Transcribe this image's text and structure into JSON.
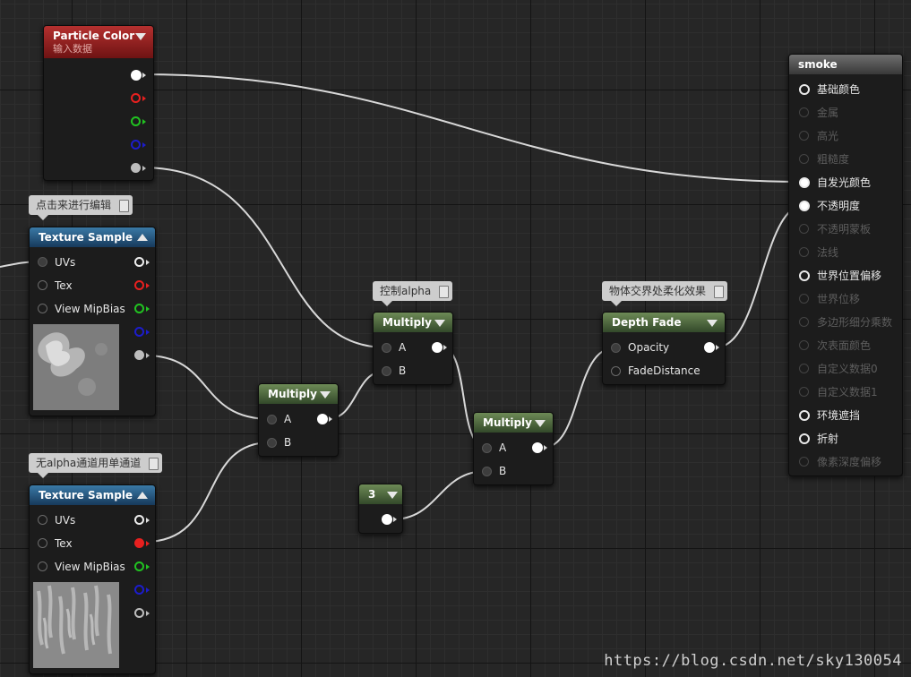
{
  "particle_color": {
    "title": "Particle Color",
    "subtitle": "输入数据"
  },
  "texture_sample_1": {
    "comment": "点击来进行编辑",
    "title": "Texture Sample",
    "inputs": [
      "UVs",
      "Tex",
      "View MipBias"
    ]
  },
  "texture_sample_2": {
    "comment": "无alpha通道用单通道",
    "title": "Texture Sample",
    "inputs": [
      "UVs",
      "Tex",
      "View MipBias"
    ]
  },
  "multiply_1": {
    "title": "Multiply",
    "inputs": [
      "A",
      "B"
    ]
  },
  "multiply_2": {
    "comment": "控制alpha",
    "title": "Multiply",
    "inputs": [
      "A",
      "B"
    ]
  },
  "multiply_3": {
    "title": "Multiply",
    "inputs": [
      "A",
      "B"
    ]
  },
  "constant": {
    "title": "3"
  },
  "depth_fade": {
    "comment": "物体交界处柔化效果",
    "title": "Depth Fade",
    "inputs": [
      "Opacity",
      "FadeDistance"
    ]
  },
  "material": {
    "title": "smoke",
    "inputs": [
      {
        "label": "基础颜色",
        "active": true
      },
      {
        "label": "金属",
        "active": false
      },
      {
        "label": "高光",
        "active": false
      },
      {
        "label": "粗糙度",
        "active": false
      },
      {
        "label": "自发光颜色",
        "active": true
      },
      {
        "label": "不透明度",
        "active": true
      },
      {
        "label": "不透明蒙板",
        "active": false
      },
      {
        "label": "法线",
        "active": false
      },
      {
        "label": "世界位置偏移",
        "active": true
      },
      {
        "label": "世界位移",
        "active": false
      },
      {
        "label": "多边形细分乘数",
        "active": false
      },
      {
        "label": "次表面颜色",
        "active": false
      },
      {
        "label": "自定义数据0",
        "active": false
      },
      {
        "label": "自定义数据1",
        "active": false
      },
      {
        "label": "环境遮挡",
        "active": true
      },
      {
        "label": "折射",
        "active": true
      },
      {
        "label": "像素深度偏移",
        "active": false
      }
    ]
  },
  "pin_colors": {
    "white": "#ffffff",
    "red": "#e8201f",
    "green": "#21c221",
    "blue": "#1c1ccc",
    "gray": "#bdbdbd"
  },
  "watermark": "https://blog.csdn.net/sky130054"
}
